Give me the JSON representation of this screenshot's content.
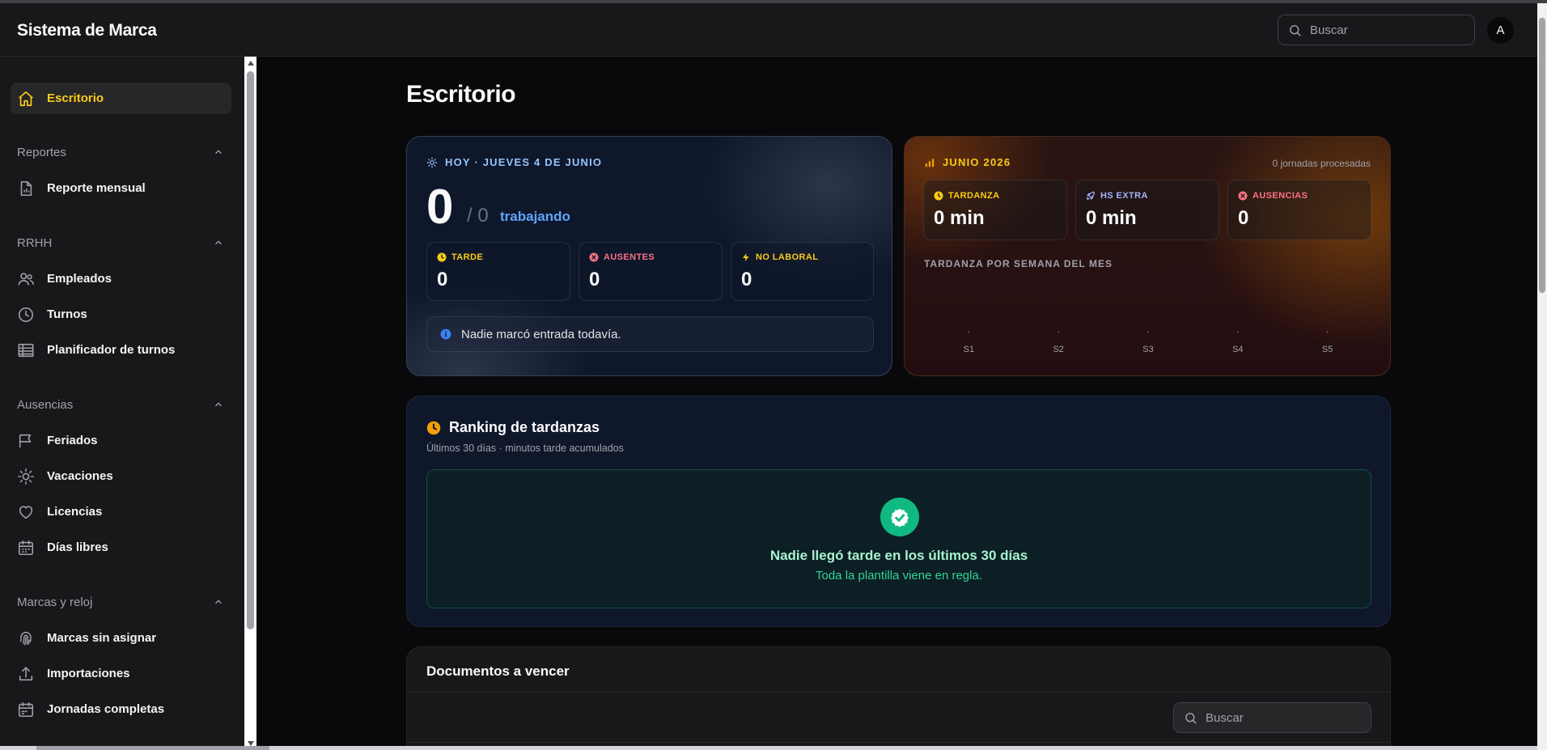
{
  "app": {
    "title": "Sistema de Marca",
    "avatar_initial": "A"
  },
  "header": {
    "search_placeholder": "Buscar"
  },
  "sidebar": {
    "active": {
      "label": "Escritorio",
      "icon": "home-icon"
    },
    "sections": [
      {
        "title": "Reportes",
        "items": [
          {
            "label": "Reporte mensual",
            "icon": "file-chart-icon"
          }
        ]
      },
      {
        "title": "RRHH",
        "items": [
          {
            "label": "Empleados",
            "icon": "users-icon"
          },
          {
            "label": "Turnos",
            "icon": "clock-icon"
          },
          {
            "label": "Planificador de turnos",
            "icon": "table-icon"
          }
        ]
      },
      {
        "title": "Ausencias",
        "items": [
          {
            "label": "Feriados",
            "icon": "flag-icon"
          },
          {
            "label": "Vacaciones",
            "icon": "sun-icon"
          },
          {
            "label": "Licencias",
            "icon": "heart-icon"
          },
          {
            "label": "Días libres",
            "icon": "calendar-icon"
          }
        ]
      },
      {
        "title": "Marcas y reloj",
        "items": [
          {
            "label": "Marcas sin asignar",
            "icon": "fingerprint-icon"
          },
          {
            "label": "Importaciones",
            "icon": "upload-icon"
          },
          {
            "label": "Jornadas completas",
            "icon": "calendar-check-icon"
          }
        ]
      }
    ]
  },
  "main": {
    "title": "Escritorio",
    "today": {
      "eyebrow": "HOY · JUEVES 4 DE JUNIO",
      "working_count": "0",
      "total": "/ 0",
      "working_label": "trabajando",
      "stats": [
        {
          "label": "TARDE",
          "value": "0",
          "color": "#facc15",
          "icon": "clock-icon"
        },
        {
          "label": "AUSENTES",
          "value": "0",
          "color": "#fb7185",
          "icon": "x-circle-icon"
        },
        {
          "label": "NO LABORAL",
          "value": "0",
          "color": "#facc15",
          "icon": "bolt-icon"
        }
      ],
      "notice": "Nadie marcó entrada todavía."
    },
    "month": {
      "eyebrow": "JUNIO 2026",
      "processed": "0 jornadas procesadas",
      "stats": [
        {
          "label": "TARDANZA",
          "value": "0 min",
          "color": "#facc15",
          "icon": "clock-icon"
        },
        {
          "label": "HS EXTRA",
          "value": "0 min",
          "color": "#a5b4fc",
          "icon": "rocket-icon"
        },
        {
          "label": "AUSENCIAS",
          "value": "0",
          "color": "#fb7185",
          "icon": "x-circle-icon"
        }
      ],
      "chart_title": "TARDANZA POR SEMANA DEL MES"
    },
    "ranking": {
      "title": "Ranking de tardanzas",
      "subtitle": "Últimos 30 días · minutos tarde acumulados",
      "empty_title": "Nadie llegó tarde en los últimos 30 días",
      "empty_sub": "Toda la plantilla viene en regla."
    },
    "documents": {
      "title": "Documentos a vencer",
      "search_placeholder": "Buscar"
    }
  },
  "chart_data": {
    "type": "bar",
    "title": "TARDANZA POR SEMANA DEL MES",
    "categories": [
      "S1",
      "S2",
      "S3",
      "S4",
      "S5"
    ],
    "values": [
      0,
      0,
      0,
      0,
      0
    ],
    "color": "#f59e0b",
    "grid": false
  },
  "colors": {
    "accent": "#facc15",
    "background": "#09090b",
    "panel": "#18181b",
    "info": "#60a5fa",
    "success": "#10b981"
  }
}
